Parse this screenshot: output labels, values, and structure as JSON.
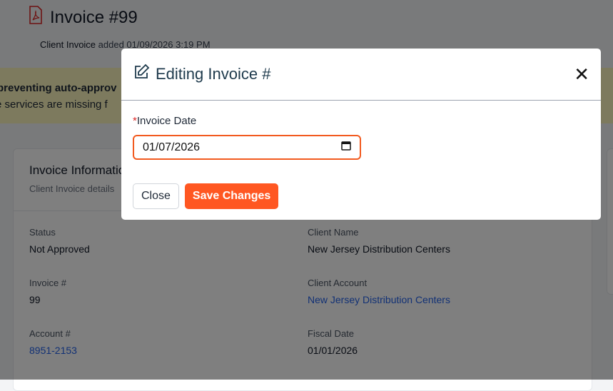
{
  "header": {
    "title": "Invoice #99",
    "type": "Client Invoice",
    "added": "added 01/09/2026 3:19 PM"
  },
  "banner": {
    "line1": "preventing auto-approv",
    "line2": "e services are missing f"
  },
  "card": {
    "title": "Invoice Information",
    "subtitle": "Client Invoice details",
    "fields": [
      {
        "label": "Status",
        "value": "Not Approved",
        "link": false
      },
      {
        "label": "Client Name",
        "value": "New Jersey Distribution Centers",
        "link": false
      },
      {
        "label": "Invoice #",
        "value": "99",
        "link": false
      },
      {
        "label": "Client Account",
        "value": "New Jersey Distribution Centers",
        "link": true
      },
      {
        "label": "Account #",
        "value": "8951-2153",
        "link": true
      },
      {
        "label": "Fiscal Date",
        "value": "01/01/2026",
        "link": false
      }
    ]
  },
  "modal": {
    "title": "Editing Invoice #",
    "required": "*",
    "date_label": "Invoice Date",
    "date_value": "01/07/2026",
    "close_label": "Close",
    "save_label": "Save Changes"
  },
  "colors": {
    "accent": "#ff5722",
    "link": "#2563eb"
  }
}
